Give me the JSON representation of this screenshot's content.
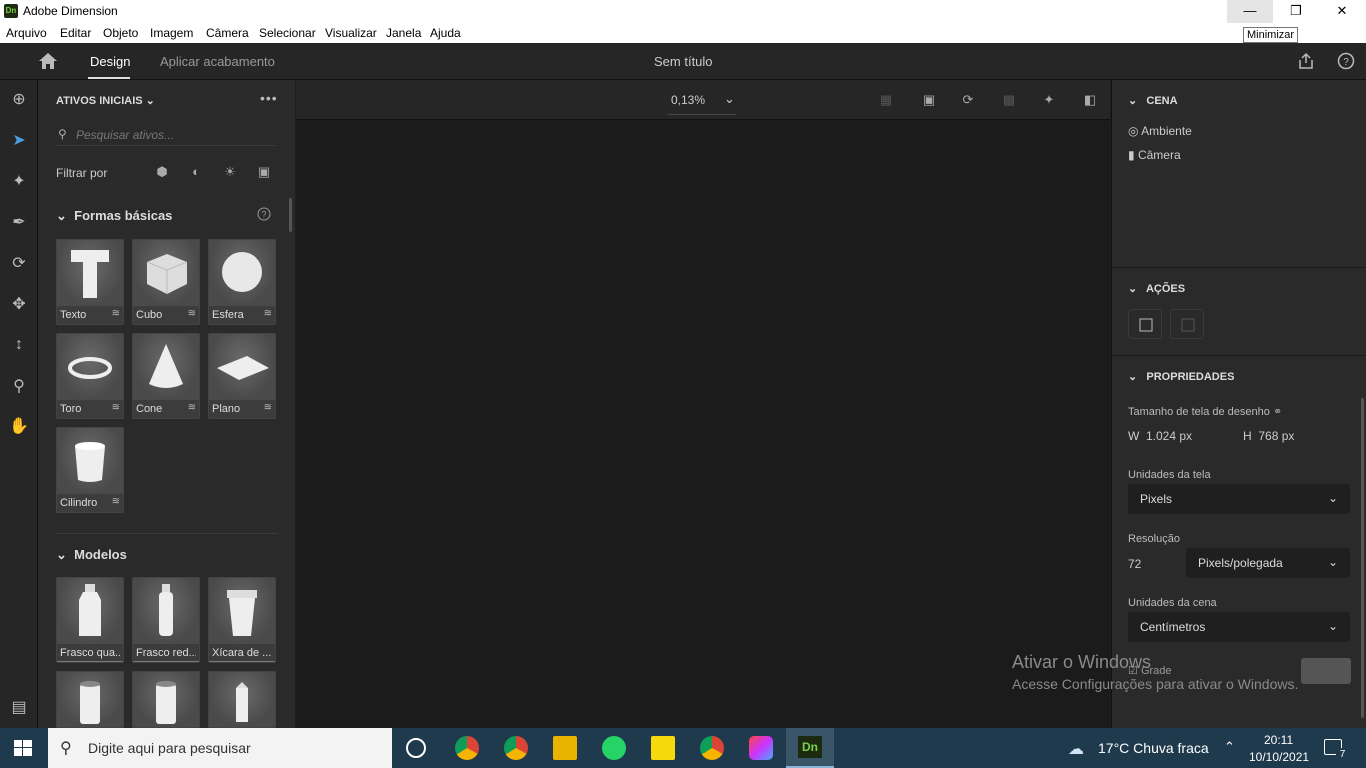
{
  "window": {
    "title": "Adobe Dimension",
    "logo": "Dn",
    "tooltip": "Minimizar"
  },
  "menu": [
    "Arquivo",
    "Editar",
    "Objeto",
    "Imagem",
    "Câmera",
    "Selecionar",
    "Visualizar",
    "Janela",
    "Ajuda"
  ],
  "appbar": {
    "tab_design": "Design",
    "tab_render": "Aplicar acabamento",
    "document_title": "Sem título"
  },
  "assets": {
    "header": "ATIVOS INICIAIS",
    "search_placeholder": "Pesquisar ativos...",
    "filter_label": "Filtrar por",
    "section_basic": "Formas básicas",
    "basic_shapes": [
      "Texto",
      "Cubo",
      "Esfera",
      "Toro",
      "Cone",
      "Plano",
      "Cilindro"
    ],
    "section_models": "Modelos",
    "models": [
      "Frasco qua...",
      "Frasco red...",
      "Xícara de ..."
    ]
  },
  "viewport": {
    "zoom": "0,13%"
  },
  "scene": {
    "section": "CENA",
    "items": [
      "Ambiente",
      "Câmera"
    ],
    "actions_section": "AÇÕES",
    "properties_section": "PROPRIEDADES",
    "canvas_size_label": "Tamanho de tela de desenho",
    "w_label": "W",
    "w_value": "1.024 px",
    "h_label": "H",
    "h_value": "768 px",
    "canvas_units_label": "Unidades da tela",
    "canvas_units_value": "Pixels",
    "resolution_label": "Resolução",
    "resolution_value": "72",
    "resolution_unit": "Pixels/polegada",
    "scene_units_label": "Unidades da cena",
    "scene_units_value": "Centímetros",
    "grid_label": "Grade"
  },
  "watermark": {
    "line1": "Ativar o Windows",
    "line2": "Acesse Configurações para ativar o Windows."
  },
  "taskbar": {
    "search_placeholder": "Digite aqui para pesquisar",
    "weather": "17°C  Chuva fraca",
    "time": "20:11",
    "date": "10/10/2021",
    "notifications": "7"
  }
}
